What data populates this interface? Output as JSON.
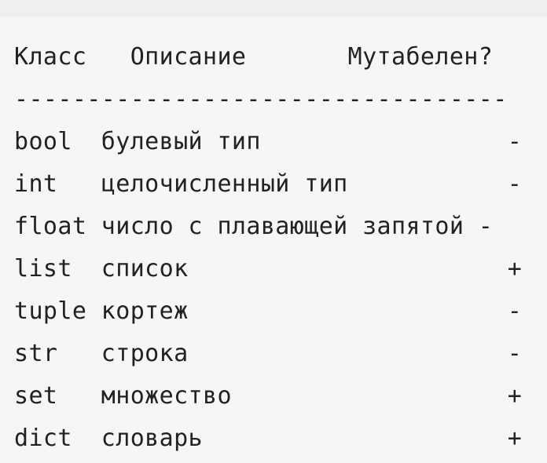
{
  "table": {
    "header": "Класс   Описание       Мутабелен?",
    "separator": "----------------------------------",
    "rows": [
      "bool  булевый тип                 -",
      "int   целочисленный тип           -",
      "float число с плавающей запятой -",
      "list  список                      +",
      "tuple кортеж                      -",
      "str   строка                      -",
      "set   множество                   +",
      "dict  словарь                     +"
    ]
  }
}
